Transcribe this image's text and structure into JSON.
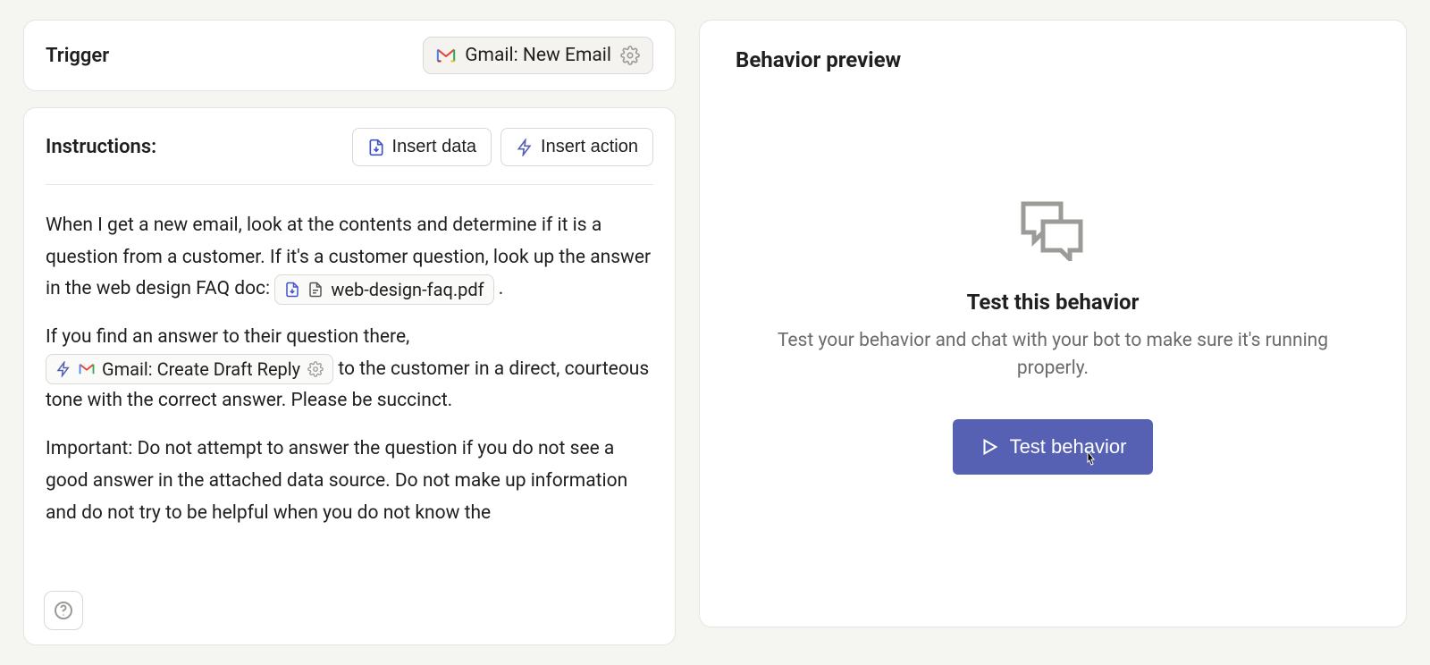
{
  "trigger": {
    "label": "Trigger",
    "selected": "Gmail: New Email"
  },
  "instructions": {
    "title": "Instructions:",
    "insert_data_label": "Insert data",
    "insert_action_label": "Insert action",
    "text_1": "When I get a new email, look at the contents and determine if it is a question from a customer. If it's a customer question, look up the answer in the web design FAQ doc: ",
    "file_chip": "web-design-faq.pdf",
    "text_1_end": " .",
    "text_2": "If you find an answer to their question there, ",
    "action_chip": "Gmail: Create Draft Reply",
    "text_2_end": " to the customer in a direct, courteous tone with the correct answer. Please be succinct.",
    "text_3": "Important: Do not attempt to answer the question if you do not see a good answer in the attached data source. Do not make up information and do not try to be helpful when you do not know the"
  },
  "preview": {
    "panel_title": "Behavior preview",
    "heading": "Test this behavior",
    "subtext": "Test your behavior and chat with your bot to make sure it's running properly.",
    "button_label": "Test behavior"
  }
}
